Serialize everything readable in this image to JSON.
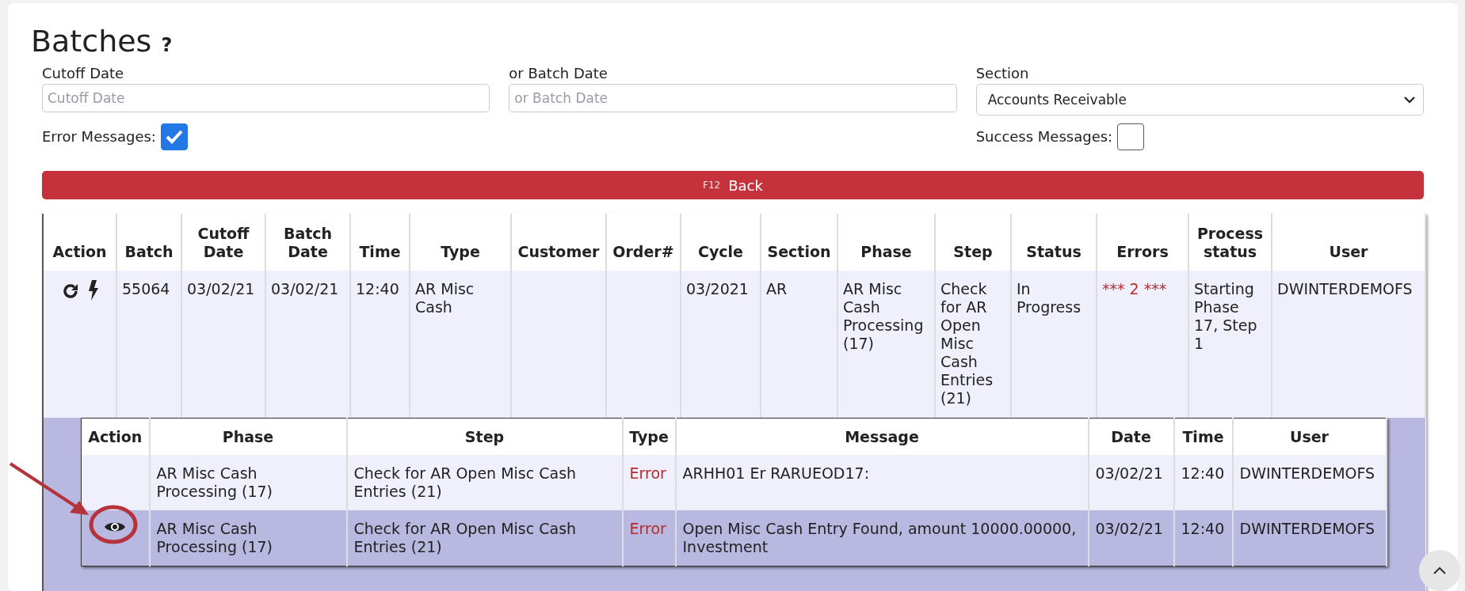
{
  "page": {
    "title": "Batches",
    "help": "?"
  },
  "filters": {
    "cutoff_date": {
      "label": "Cutoff Date",
      "placeholder": "Cutoff Date"
    },
    "batch_date": {
      "label": "or Batch Date",
      "placeholder": "or Batch Date"
    },
    "section": {
      "label": "Section",
      "value": "Accounts Receivable"
    },
    "error_messages": {
      "label": "Error Messages:",
      "checked": true
    },
    "success_messages": {
      "label": "Success Messages:",
      "checked": false
    }
  },
  "back_button": {
    "key": "F12",
    "label": "Back"
  },
  "table": {
    "columns": [
      {
        "label": "Action",
        "kind": "action"
      },
      {
        "label": "Batch",
        "kind": "text"
      },
      {
        "label": "Cutoff Date",
        "kind": "text"
      },
      {
        "label": "Batch Date",
        "kind": "text"
      },
      {
        "label": "Time",
        "kind": "text"
      },
      {
        "label": "Type",
        "kind": "text"
      },
      {
        "label": "Customer",
        "kind": "text"
      },
      {
        "label": "Order#",
        "kind": "text"
      },
      {
        "label": "Cycle",
        "kind": "text"
      },
      {
        "label": "Section",
        "kind": "text"
      },
      {
        "label": "Phase",
        "kind": "text"
      },
      {
        "label": "Step",
        "kind": "text"
      },
      {
        "label": "Status",
        "kind": "text"
      },
      {
        "label": "Errors",
        "kind": "error"
      },
      {
        "label": "Process status",
        "kind": "text"
      },
      {
        "label": "User",
        "kind": "text"
      }
    ],
    "rows": [
      {
        "actions": [
          {
            "kind": "refresh"
          },
          {
            "kind": "run"
          }
        ],
        "cells": [
          null,
          "55064",
          "03/02/21",
          "03/02/21",
          "12:40",
          "AR Misc Cash",
          null,
          null,
          "03/2021",
          "AR",
          "AR Misc Cash Processing (17)",
          "Check for AR Open Misc Cash Entries (21)",
          "In Progress",
          "*** 2 ***",
          "Starting Phase 17, Step 1",
          "DWINTERDEMOFS"
        ],
        "details": {
          "columns": [
            {
              "label": "Action",
              "kind": "action"
            },
            {
              "label": "Phase",
              "kind": "text"
            },
            {
              "label": "Step",
              "kind": "text"
            },
            {
              "label": "Type",
              "kind": "error"
            },
            {
              "label": "Message",
              "kind": "text"
            },
            {
              "label": "Date",
              "kind": "text"
            },
            {
              "label": "Time",
              "kind": "text"
            },
            {
              "label": "User",
              "kind": "text"
            }
          ],
          "rows": [
            {
              "selected": false,
              "actions": [],
              "cells": [
                null,
                "AR Misc Cash Processing (17)",
                "Check for AR Open Misc Cash Entries (21)",
                "Error",
                "ARHH01 Er RARUEOD17:",
                "03/02/21",
                "12:40",
                "DWINTERDEMOFS"
              ]
            },
            {
              "selected": true,
              "actions": [
                {
                  "kind": "view"
                }
              ],
              "cells": [
                null,
                "AR Misc Cash Processing (17)",
                "Check for AR Open Misc Cash Entries (21)",
                "Error",
                "Open Misc Cash Entry Found, amount 10000.00000, Investment",
                "03/02/21",
                "12:40",
                "DWINTERDEMOFS"
              ]
            }
          ]
        }
      }
    ]
  }
}
